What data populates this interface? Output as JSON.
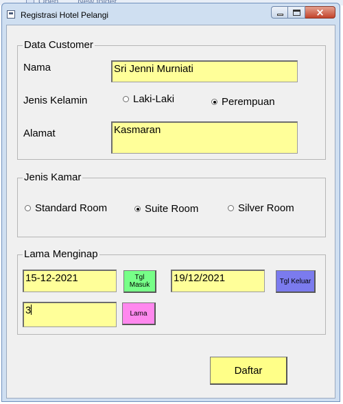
{
  "background": {
    "open": "Open",
    "new_folder": "New folder"
  },
  "window": {
    "title": "Registrasi Hotel Pelangi",
    "close_glyph": "×"
  },
  "data_customer": {
    "legend": "Data Customer",
    "nama_label": "Nama",
    "nama_value": "Sri Jenni Murniati",
    "jenis_kelamin_label": "Jenis Kelamin",
    "gender_options": [
      {
        "label": "Laki-Laki",
        "checked": false
      },
      {
        "label": "Perempuan",
        "checked": true
      }
    ],
    "alamat_label": "Alamat",
    "alamat_value": "Kasmaran"
  },
  "jenis_kamar": {
    "legend": "Jenis Kamar",
    "options": [
      {
        "label": "Standard Room",
        "checked": false
      },
      {
        "label": "Suite Room",
        "checked": true
      },
      {
        "label": "Silver Room",
        "checked": false
      }
    ]
  },
  "lama_menginap": {
    "legend": "Lama Menginap",
    "tgl_masuk_value": "15-12-2021",
    "tgl_masuk_button": "Tgl Masuk",
    "tgl_keluar_value": "19/12/2021",
    "tgl_keluar_button": "Tgl Keluar",
    "lama_value": "3",
    "lama_button": "Lama"
  },
  "daftar_button": "Daftar",
  "colors": {
    "field_bg": "#ffff99",
    "btn_tgl_masuk": "#77ff88",
    "btn_tgl_keluar": "#7b7bee",
    "btn_lama": "#ff88ee",
    "btn_daftar": "#ffff88"
  }
}
